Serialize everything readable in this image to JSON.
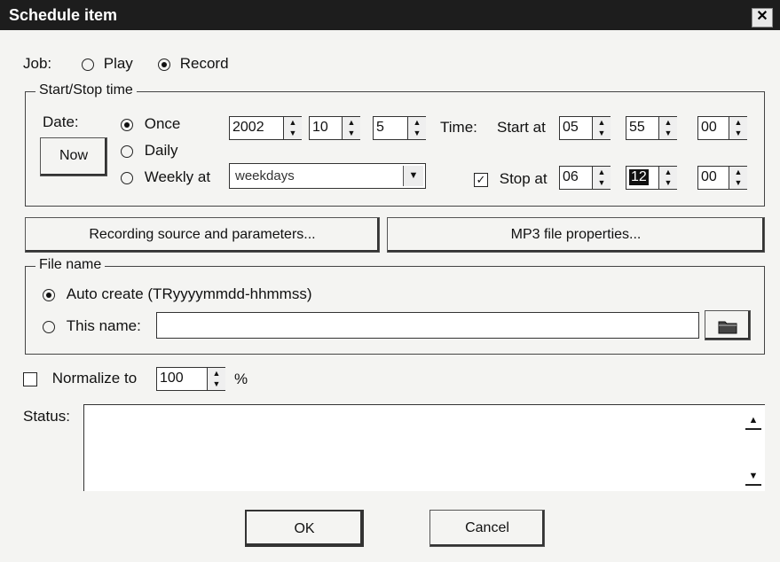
{
  "window": {
    "title": "Schedule item",
    "close_symbol": "✕"
  },
  "job": {
    "label": "Job:",
    "play_label": "Play",
    "record_label": "Record",
    "selected": "Record"
  },
  "schedule": {
    "group_label": "Start/Stop time",
    "date_label": "Date:",
    "now_button": "Now",
    "once_label": "Once",
    "daily_label": "Daily",
    "weekly_label": "Weekly at",
    "weekly_value": "weekdays",
    "selected_frequency": "Once",
    "year": "2002",
    "month": "10",
    "day": "5",
    "time_label": "Time:",
    "start_label": "Start at",
    "start_hour": "05",
    "start_minute": "55",
    "start_second": "00",
    "stop_label": "Stop at",
    "stop_checked": true,
    "stop_hour": "06",
    "stop_minute": "12",
    "stop_second": "00"
  },
  "buttons": {
    "recording_source": "Recording source and parameters...",
    "mp3_properties": "MP3 file properties...",
    "ok": "OK",
    "cancel": "Cancel"
  },
  "file_name": {
    "group_label": "File name",
    "auto_create_label": "Auto create (TRyyyymmdd-hhmmss)",
    "this_name_label": "This name:",
    "this_name_value": "",
    "selected": "Auto create"
  },
  "normalize": {
    "label": "Normalize to",
    "checked": false,
    "value": "100",
    "unit": "%"
  },
  "status": {
    "label": "Status:",
    "text": ""
  }
}
